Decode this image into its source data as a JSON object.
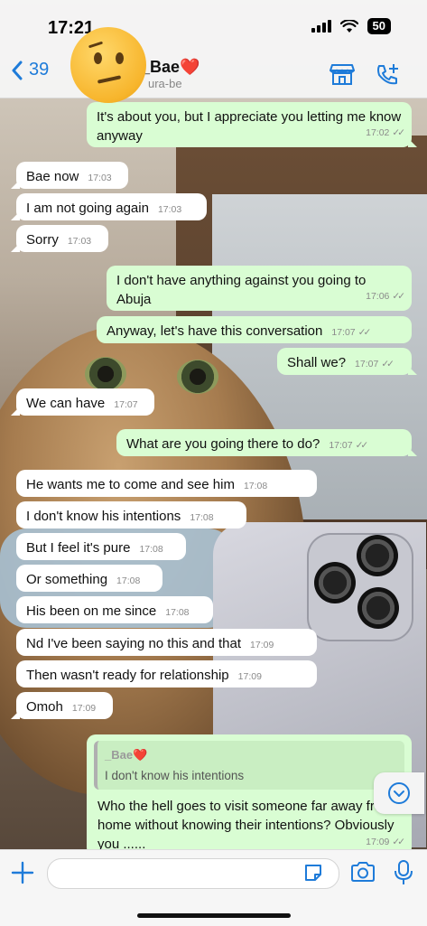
{
  "status_bar": {
    "time": "17:21",
    "battery": "50"
  },
  "header": {
    "back_count": "39",
    "contact_name": "_Bae❤️",
    "contact_sub": "ura-be",
    "store_icon": "store-icon",
    "add_call_icon": "add-call-icon"
  },
  "messages": [
    {
      "dir": "out",
      "text": "It's about you, but I appreciate you letting me know anyway",
      "time": "17:02"
    },
    {
      "dir": "in",
      "text": "Bae now",
      "time": "17:03"
    },
    {
      "dir": "in",
      "text": "I am not going again",
      "time": "17:03"
    },
    {
      "dir": "in",
      "text": "Sorry",
      "time": "17:03"
    },
    {
      "dir": "out",
      "text": "I don't have anything against you going to Abuja",
      "time": "17:06"
    },
    {
      "dir": "out",
      "text": "Anyway, let's have this conversation",
      "time": "17:07"
    },
    {
      "dir": "out",
      "text": "Shall we?",
      "time": "17:07"
    },
    {
      "dir": "in",
      "text": "We can have",
      "time": "17:07"
    },
    {
      "dir": "out",
      "text": "What are you going there to do?",
      "time": "17:07"
    },
    {
      "dir": "in",
      "text": "He wants me to come and see him",
      "time": "17:08"
    },
    {
      "dir": "in",
      "text": "I don't know his intentions",
      "time": "17:08"
    },
    {
      "dir": "in",
      "text": "But I feel it's pure",
      "time": "17:08"
    },
    {
      "dir": "in",
      "text": "Or something",
      "time": "17:08"
    },
    {
      "dir": "in",
      "text": "His been on me since",
      "time": "17:08"
    },
    {
      "dir": "in",
      "text": "Nd I've been saying no this and that",
      "time": "17:09"
    },
    {
      "dir": "in",
      "text": "Then wasn't ready for relationship",
      "time": "17:09"
    },
    {
      "dir": "in",
      "text": "Omoh",
      "time": "17:09"
    },
    {
      "dir": "out",
      "quote_name": "_Bae❤️",
      "quote_text": "I don't know his intentions",
      "text": "Who the hell goes to visit someone far away from home without knowing their intentions? Obviously you ......",
      "time": "17:09"
    }
  ],
  "colors": {
    "accent": "#1e7bd9",
    "outgoing_bubble": "#d9fdd3",
    "incoming_bubble": "#ffffff"
  },
  "input_bar": {
    "placeholder": ""
  }
}
